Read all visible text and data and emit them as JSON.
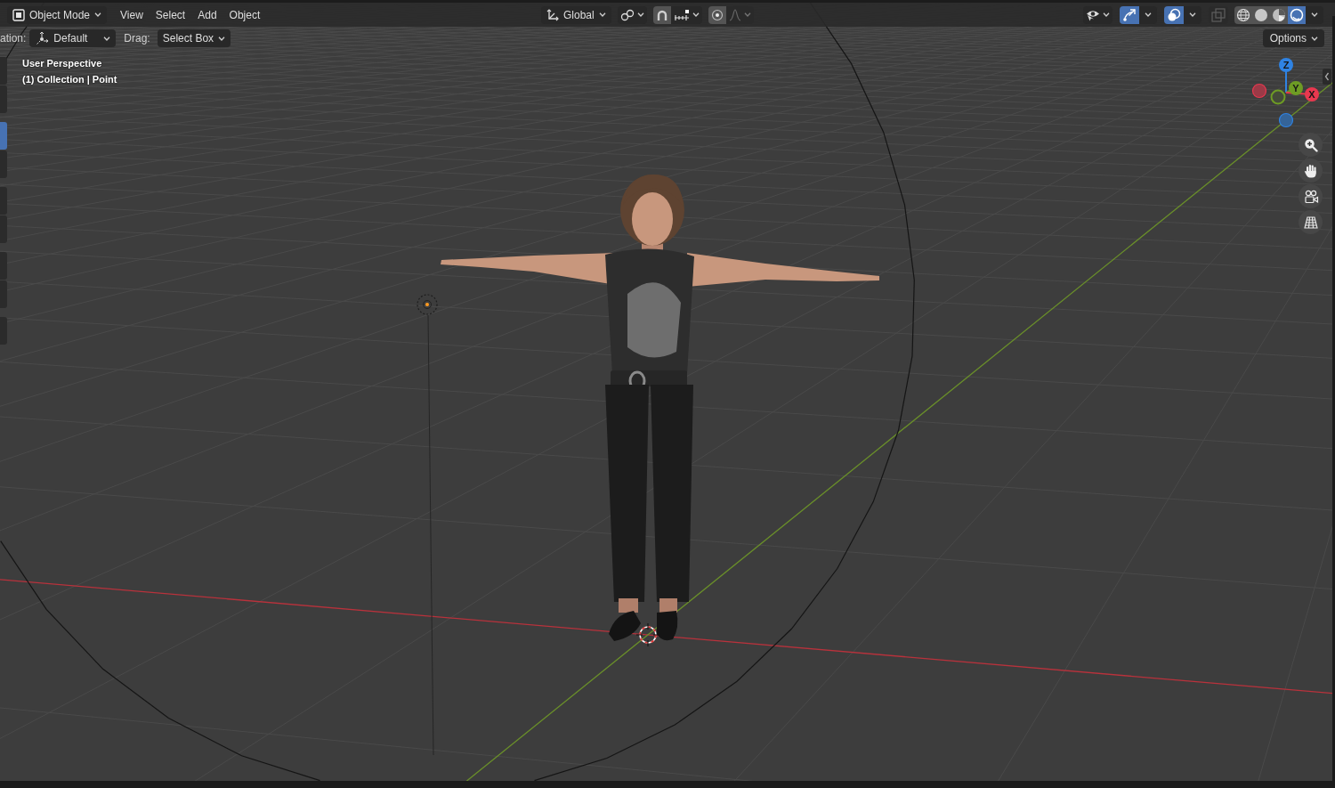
{
  "header": {
    "mode_menu": {
      "label": "Object Mode"
    },
    "menus": [
      {
        "label": "View"
      },
      {
        "label": "Select"
      },
      {
        "label": "Add"
      },
      {
        "label": "Object"
      }
    ],
    "center_controls": [
      {
        "kind": "dropdown",
        "label": "Global",
        "disabled": false
      },
      {
        "kind": "icon_dropdown",
        "disabled": false
      },
      {
        "kind": "toggle",
        "on": true,
        "disabled": false
      },
      {
        "kind": "icon_dropdown",
        "disabled": false
      },
      {
        "kind": "toggle",
        "on": true,
        "disabled": false
      },
      {
        "kind": "icon_dropdown",
        "disabled": true
      }
    ],
    "right_controls": [
      {
        "kind": "icon_dropdown",
        "disabled": false
      },
      {
        "kind": "split_toggle",
        "on": true,
        "disabled": false
      },
      {
        "kind": "split_toggle",
        "on": true,
        "disabled": false
      },
      {
        "kind": "toggle",
        "on": false,
        "disabled": true
      }
    ],
    "shading_modes": [
      {
        "selected": false
      },
      {
        "selected": false
      },
      {
        "selected": false
      },
      {
        "selected": true
      }
    ]
  },
  "tool_settings": {
    "orientation_label": "ation:",
    "orientation": "Default",
    "drag_label": "Drag:",
    "drag": "Select Box",
    "options": "Options"
  },
  "viewport": {
    "view_name": "User Perspective",
    "scene_info": "(1) Collection | Point",
    "toolbar": {
      "groups": [
        [
          {
            "selected": false
          },
          {
            "selected": false
          }
        ],
        [
          {
            "selected": true
          },
          {
            "selected": false
          }
        ],
        [
          {
            "selected": false
          },
          {
            "selected": false
          }
        ],
        [
          {
            "selected": false
          },
          {
            "selected": false
          }
        ],
        [
          {
            "selected": false
          }
        ]
      ]
    },
    "gizmo": {
      "axes": [
        {
          "label": "Z",
          "color": "#2f83e3"
        },
        {
          "label": "Y",
          "color": "#6e9c24"
        },
        {
          "label": "X",
          "color": "#e8384f"
        }
      ]
    }
  }
}
